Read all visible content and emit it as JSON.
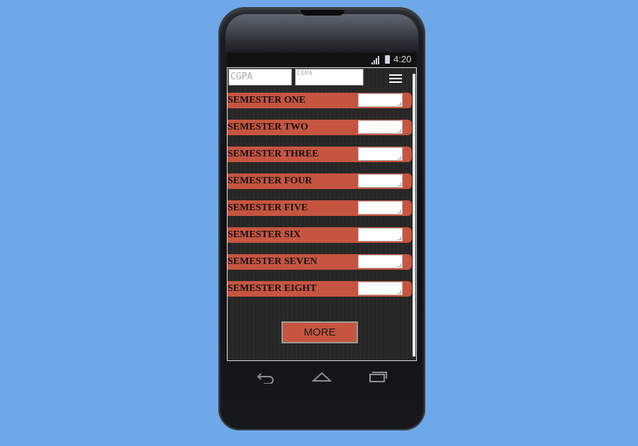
{
  "status_bar": {
    "time": "4:20"
  },
  "inputs": {
    "cgpa_placeholder_1": "CGPA",
    "cgpa_placeholder_2": "CGPA"
  },
  "semesters": [
    {
      "label": "SEMESTER ONE",
      "value": ""
    },
    {
      "label": "SEMESTER TWO",
      "value": ""
    },
    {
      "label": "SEMESTER THREE",
      "value": ""
    },
    {
      "label": "SEMESTER FOUR",
      "value": ""
    },
    {
      "label": "SEMESTER FIVE",
      "value": ""
    },
    {
      "label": "SEMESTER SIX",
      "value": ""
    },
    {
      "label": "SEMESTER SEVEN",
      "value": ""
    },
    {
      "label": "SEMESTER EIGHT",
      "value": ""
    }
  ],
  "buttons": {
    "more_label": "MORE"
  },
  "icons": {
    "menu": "hamburger-menu-icon",
    "signal": "signal-icon",
    "battery": "battery-icon",
    "back": "back-icon",
    "home": "home-icon",
    "recent": "recent-apps-icon"
  },
  "colors": {
    "background": "#6fa8e8",
    "accent": "#c65540",
    "screen": "#262626"
  }
}
